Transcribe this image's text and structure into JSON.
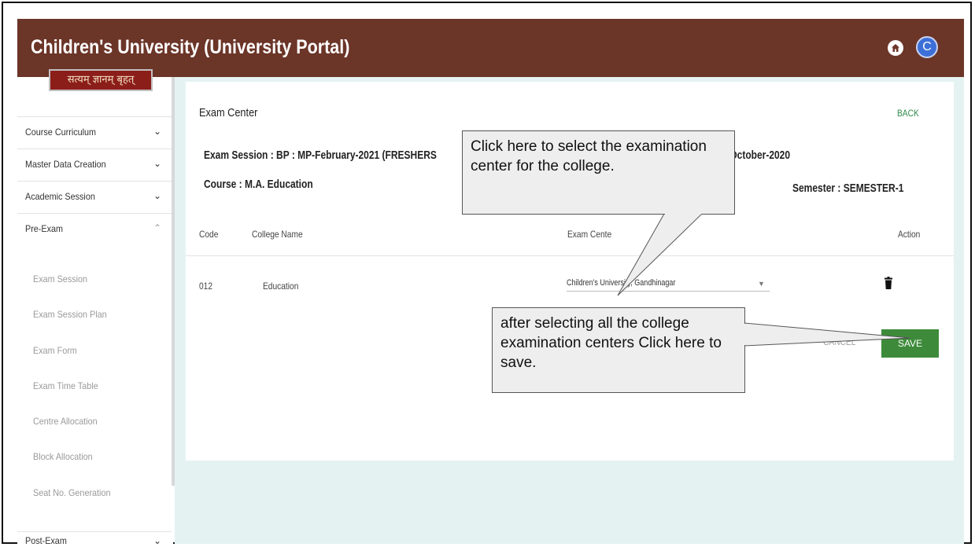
{
  "app": {
    "title": "Children's University (University Portal)",
    "avatar_letter": "C",
    "logo_text": "सत्यम् ज्ञानम् बृहत्"
  },
  "colors": {
    "header": "#6b3528",
    "accent_green": "#3d8b3a",
    "content_bg": "#e5f2f2",
    "avatar": "#3d6fd8"
  },
  "sidebar": {
    "items": [
      {
        "label": "Course Curriculum",
        "icon": "chevron-down-icon"
      },
      {
        "label": "Master Data Creation",
        "icon": "chevron-down-icon"
      },
      {
        "label": "Academic Session",
        "icon": "chevron-down-icon"
      },
      {
        "label": "Pre-Exam",
        "icon": "chevron-up-icon"
      }
    ],
    "subitems": [
      "Exam Session",
      "Exam Session Plan",
      "Exam Form",
      "Exam Time Table",
      "Centre Allocation",
      "Block Allocation",
      "Seat No. Generation"
    ],
    "post_exam_label": "Post-Exam"
  },
  "page": {
    "title": "Exam Center",
    "back_label": "BACK",
    "exam_session": "Exam Session : BP : MP-February-2021 (FRESHERS",
    "session_suffix": ": October-2020",
    "course": "Course : M.A. Education",
    "semester": "Semester : SEMESTER-1"
  },
  "table": {
    "headers": {
      "code": "Code",
      "college": "College Name",
      "center": "Exam Cente",
      "action": "Action"
    },
    "rows": [
      {
        "code": "012",
        "college": "Education",
        "center": "Children's University, Gandhinagar"
      }
    ]
  },
  "buttons": {
    "cancel": "CANCEL",
    "save": "SAVE"
  },
  "callouts": {
    "select": "Click here to select the examination center for the college.",
    "save": "after selecting all the college examination centers Click here to save."
  }
}
